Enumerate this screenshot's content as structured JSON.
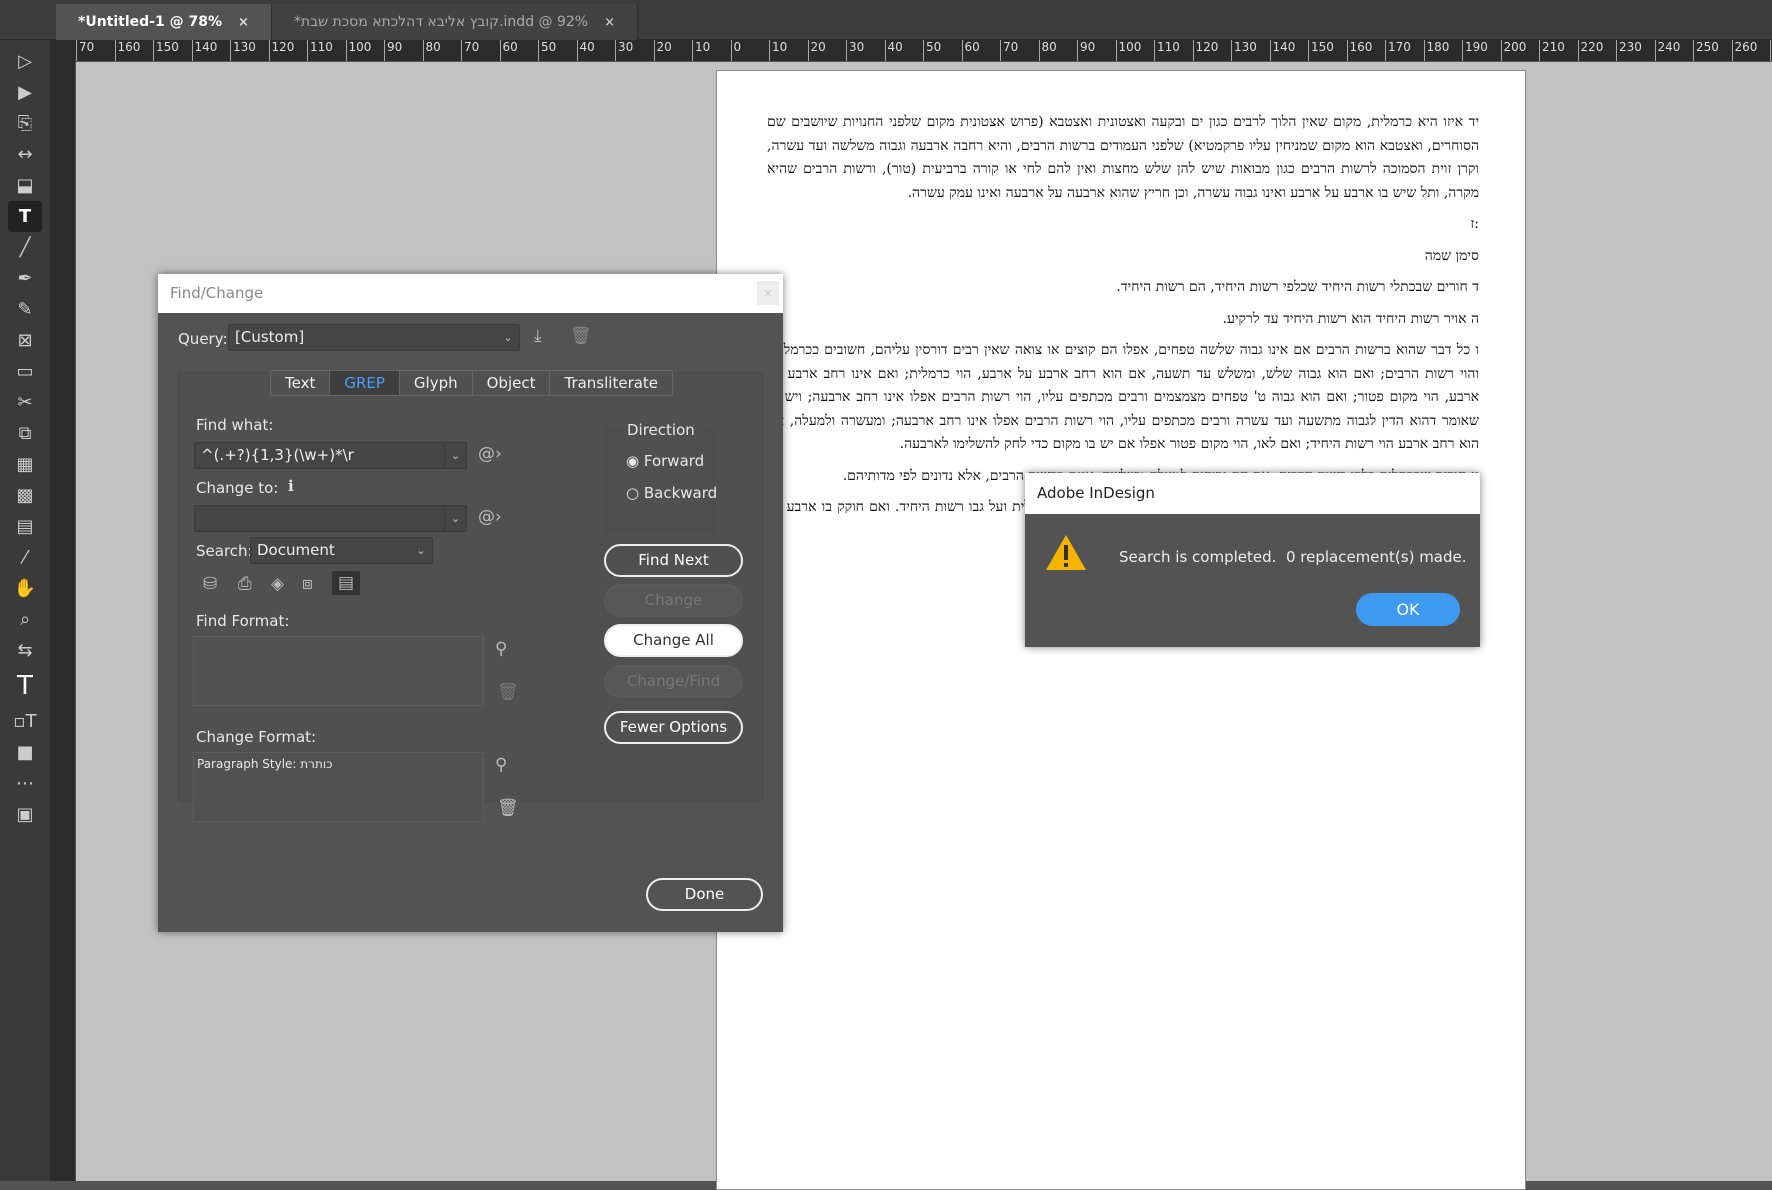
{
  "tabs": [
    {
      "label": "*Untitled-1 @ 78%",
      "close": "×"
    },
    {
      "label": "*קובץ אליבא דהלכתא מסכת שבת.indd @ 92%",
      "close": "×"
    }
  ],
  "ruler": [
    "70",
    "160",
    "150",
    "140",
    "130",
    "120",
    "110",
    "100",
    "90",
    "80",
    "70",
    "60",
    "50",
    "40",
    "30",
    "20",
    "10",
    "0",
    "10",
    "20",
    "30",
    "40",
    "50",
    "60",
    "70",
    "80",
    "90",
    "100",
    "110",
    "120",
    "130",
    "140",
    "150",
    "160",
    "170",
    "180",
    "190",
    "200",
    "210",
    "220",
    "230",
    "240",
    "250",
    "260",
    "27"
  ],
  "document": {
    "paragraphs": [
      "יד איזו היא כרמלית, מקום שאין הלוך לרבים כגון ים ובקעה ואצטונית ואצטבא (פרוש אצטונית מקום שלפני החנויות שיושבים שם הסוחרים, ואצטבא הוא מקום שמניחין עליו פרקמטיא) שלפני העמודים ברשות הרבים, והיא רחבה ארבעה וגבוה משלשה ועד עשרה, וקרן זוית הסמוכה לרשות הרבים כגון מבואות שיש להן שלש מחצות ואין להם לחי או קורה ברביעית (טור), ורשות הרבים שהיא מקרה, ותל שיש בו ארבע על ארבע ואינו גבוה עשרה, וכן חריץ שהוא ארבעה על ארבעה ואינו עמק עשרה.",
      ":ז",
      "סימן שמה",
      "ד חורים שבכתלי רשות היחיד שכלפי רשות היחיד, הם רשות היחיד.",
      "ה אויר רשות היחיד הוא רשות היחיד עד לרקיע.",
      "ו כל דבר שהוא ברשות הרבים אם אינו גבוה שלשה טפחים, אפלו הם קוצים או צואה שאין רבים דורסין עליהם, חשובים ככרמלית, והוי רשות הרבים; ואם הוא גבוה שלש, ומשלש עד תשעה, אם הוא רחב ארבע על ארבע, הוי כרמלית; ואם אינו רחב ארבע על ארבע, הוי מקום פטור; ואם הוא גבוה ט' טפחים מצמצמים ורבים מכתפים עליו, הוי רשות הרבים אפלו אינו רחב ארבעה; ויש מי שאומר דהוא הדין לגבוה מתשעה ועד עשרה ורבים מכתפים עליו, הוי רשות הרבים אפלו אינו רחב ארבעה; ומעשרה ולמעלה, אם הוא רחב ארבע הוי רשות היחיד; ואם לאו, הוי מקום פטור אפלו אם יש בו מקום כדי לחק להשלימו לארבעה.",
      "יג חורים שבכתלים כלפי רשות הרבים, אם הם גבוהים למעלה משלשה, אינם כרשות הרבים, אלא נדונים לפי מדותיהם.",
      "טו בית שאין תוכו עשרה, וקרויו משלימו לעשרה, יש בו ארבע על ארבע, תוכו כרמלית ועל גבו רשות היחיד. ואם חוקק בו ארבע על ארבע, אפלו באמצע רחוק מן הכתלים, נעשה כלו רשות היחיד.",
      ".ח"
    ]
  },
  "find_change": {
    "title": "Find/Change",
    "close": "×",
    "query_label": "Query:",
    "query_value": "[Custom]",
    "tabs": [
      "Text",
      "GREP",
      "Glyph",
      "Object",
      "Transliterate"
    ],
    "find_what_label": "Find what:",
    "find_what_value": "^(.+?){1,3}(\\w+)*\\r",
    "change_to_label": "Change to:",
    "change_to_value": "",
    "search_label": "Search:",
    "search_value": "Document",
    "direction_label": "Direction",
    "forward": "Forward",
    "backward": "Backward",
    "find_format_label": "Find Format:",
    "change_format_label": "Change Format:",
    "change_format_value": "Paragraph Style: כותרת",
    "buttons": {
      "find_next": "Find Next",
      "change": "Change",
      "change_all": "Change All",
      "change_find": "Change/Find",
      "fewer_options": "Fewer Options",
      "done": "Done"
    }
  },
  "alert": {
    "title": "Adobe InDesign",
    "message": "Search is completed.  0 replacement(s) made.",
    "ok": "OK",
    "warning_color": "#f5b400"
  }
}
